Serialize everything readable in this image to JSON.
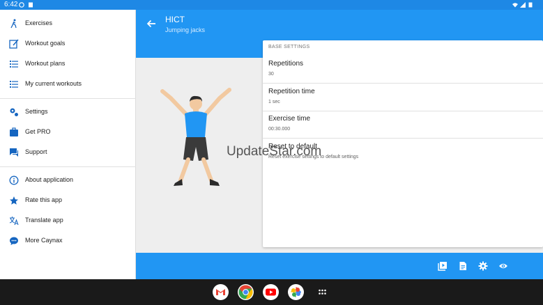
{
  "status_bar": {
    "time": "6:42"
  },
  "drawer": {
    "items": [
      {
        "label": "Exercises",
        "icon": "runner-icon"
      },
      {
        "label": "Workout goals",
        "icon": "edit-icon"
      },
      {
        "label": "Workout plans",
        "icon": "list-icon"
      },
      {
        "label": "My current workouts",
        "icon": "checklist-icon"
      },
      {
        "label": "Settings",
        "icon": "settings-icon"
      },
      {
        "label": "Get PRO",
        "icon": "pro-icon"
      },
      {
        "label": "Support",
        "icon": "chat-icon"
      },
      {
        "label": "About application",
        "icon": "info-icon"
      },
      {
        "label": "Rate this app",
        "icon": "star-icon"
      },
      {
        "label": "Translate app",
        "icon": "translate-icon"
      },
      {
        "label": "More Caynax",
        "icon": "more-chat-icon"
      }
    ]
  },
  "appbar": {
    "title": "HICT",
    "subtitle": "Jumping jacks"
  },
  "settings": {
    "header": "BASE SETTINGS",
    "rows": [
      {
        "title": "Repetitions",
        "value": "30"
      },
      {
        "title": "Repetition time",
        "value": "1 sec"
      },
      {
        "title": "Exercise time",
        "value": "00:30.000"
      },
      {
        "title": "Reset to default",
        "value": "Reset exercise settings to default settings"
      }
    ]
  },
  "watermark": "UpdateStar.com",
  "colors": {
    "primary": "#2196f3",
    "status": "#1e88e5"
  }
}
